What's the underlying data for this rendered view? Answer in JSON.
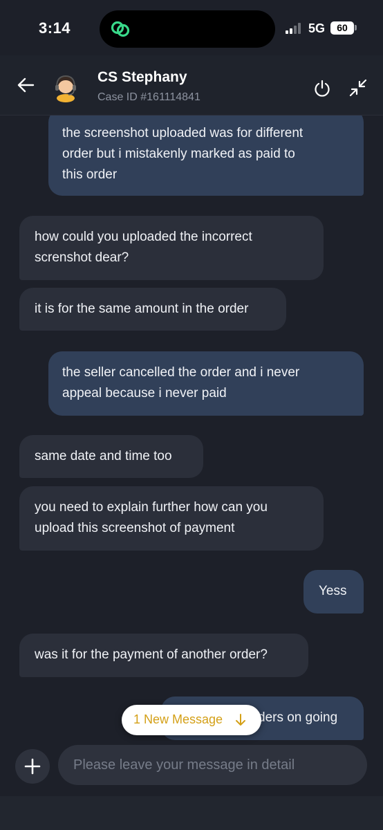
{
  "status_bar": {
    "time": "3:14",
    "network": "5G",
    "battery": "60"
  },
  "header": {
    "agent_name": "CS Stephany",
    "case_id": "Case ID #161114841"
  },
  "messages": [
    {
      "side": "out",
      "text": "the screenshot uploaded was for different\norder but i mistakenly marked as paid to\nthis order"
    },
    {
      "side": "in",
      "text": "how could you uploaded the incorrect\nscrenshot dear?"
    },
    {
      "side": "in",
      "text": "it is for the same amount in the order"
    },
    {
      "side": "out",
      "text": "the seller cancelled the order and i never\nappeal because i never paid"
    },
    {
      "side": "in",
      "text": "same date and time too"
    },
    {
      "side": "in",
      "text": "you need to explain further how can you\nupload this screenshot of payment"
    },
    {
      "side": "out",
      "text": "Yess"
    },
    {
      "side": "in",
      "text": "was it for the payment of another order?"
    },
    {
      "side": "out",
      "text": "ders on going"
    }
  ],
  "new_message_pill": {
    "label": "1 New Message"
  },
  "composer": {
    "placeholder": "Please leave your message in detail"
  },
  "colors": {
    "background": "#1d2029",
    "incoming_bubble": "#2b2f3a",
    "outgoing_bubble": "#314059",
    "pill_text": "#d4a017",
    "brand_green": "#39d98a"
  },
  "icons": [
    "back-arrow-icon",
    "agent-avatar-icon",
    "power-icon",
    "minimize-icon",
    "plus-icon",
    "arrow-down-icon",
    "chain-link-icon"
  ]
}
